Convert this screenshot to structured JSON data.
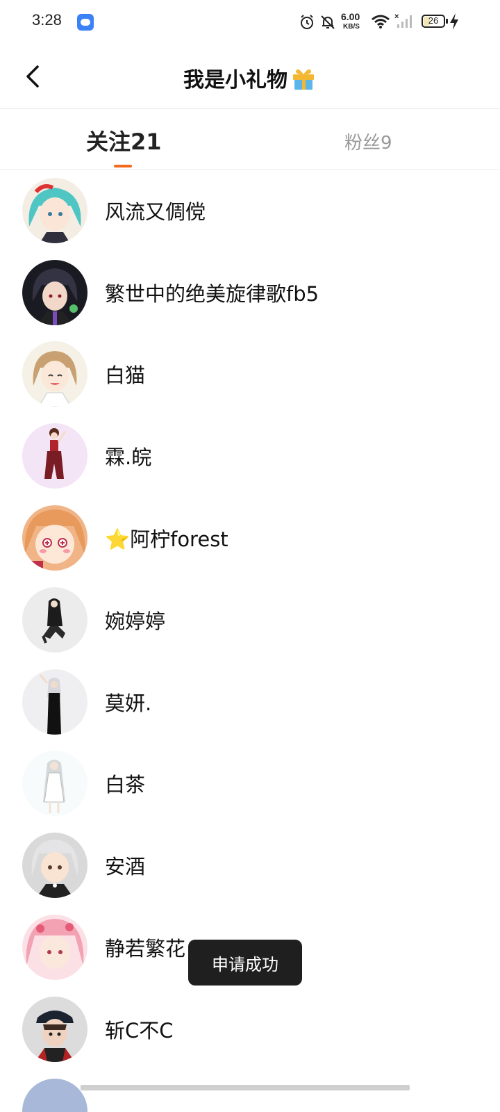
{
  "status_bar": {
    "time": "3:28",
    "network_speed": "6.00",
    "network_unit": "KB/S",
    "battery": "26"
  },
  "header": {
    "title": "我是小礼物",
    "title_emoji": "gift-icon"
  },
  "tabs": [
    {
      "label": "关注21",
      "active": true
    },
    {
      "label": "粉丝9",
      "active": false
    }
  ],
  "following": [
    {
      "name": "风流又倜傥",
      "avatar": "anime-girl-teal-hair"
    },
    {
      "name": "繁世中的绝美旋律歌fb5",
      "avatar": "anime-dark-hair"
    },
    {
      "name": "白猫",
      "avatar": "anime-girl-brown-hair"
    },
    {
      "name": "霖.皖",
      "avatar": "anime-girl-red-outfit"
    },
    {
      "name": "⭐阿柠forest",
      "avatar": "anime-girl-orange-hair"
    },
    {
      "name": "婉婷婷",
      "avatar": "anime-girl-black-hair"
    },
    {
      "name": "莫妍.",
      "avatar": "anime-girl-white-hair-black-dress"
    },
    {
      "name": "白茶",
      "avatar": "anime-girl-white-dress"
    },
    {
      "name": "安酒",
      "avatar": "anime-girl-silver-hair"
    },
    {
      "name": "静若繁花",
      "avatar": "anime-girl-pink-hair"
    },
    {
      "name": "斩C不C",
      "avatar": "anime-boy-cap"
    }
  ],
  "toast": "申请成功",
  "colors": {
    "accent": "#f26a1b",
    "inactive_tab": "#999999",
    "toast_bg": "#1f1f1f"
  }
}
